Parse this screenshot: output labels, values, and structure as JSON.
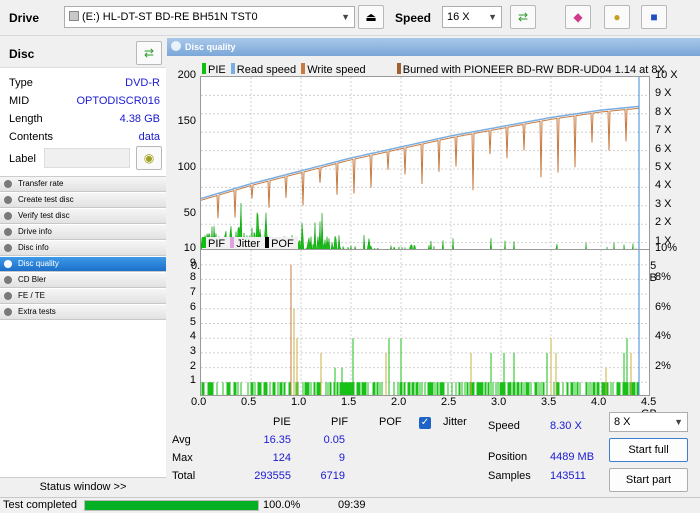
{
  "toolbar": {
    "drive_label": "Drive",
    "drive_value": "(E:)  HL-DT-ST BD-RE  BH51N TST0",
    "speed_label": "Speed",
    "speed_value": "16 X"
  },
  "disc": {
    "title": "Disc",
    "fields": [
      {
        "label": "Type",
        "value": "DVD-R"
      },
      {
        "label": "MID",
        "value": "OPTODISCR016"
      },
      {
        "label": "Length",
        "value": "4.38 GB"
      },
      {
        "label": "Contents",
        "value": "data"
      }
    ],
    "label_label": "Label",
    "label_value": ""
  },
  "nav": {
    "items": [
      {
        "label": "Transfer rate",
        "active": false
      },
      {
        "label": "Create test disc",
        "active": false
      },
      {
        "label": "Verify test disc",
        "active": false
      },
      {
        "label": "Drive info",
        "active": false
      },
      {
        "label": "Disc info",
        "active": false
      },
      {
        "label": "Disc quality",
        "active": true
      },
      {
        "label": "CD Bler",
        "active": false
      },
      {
        "label": "FE / TE",
        "active": false
      },
      {
        "label": "Extra tests",
        "active": false
      }
    ],
    "status_window": "Status window >>"
  },
  "panel": {
    "title": "Disc quality"
  },
  "chart_data": [
    {
      "type": "line",
      "legend": [
        "PIE",
        "Read speed",
        "Write speed",
        "Burned with PIONEER BD-RW   BDR-UD04 1.14 at 8X"
      ],
      "x_ticks": [
        "0.0",
        "0.5",
        "1.0",
        "1.5",
        "2.0",
        "2.5",
        "3.0",
        "3.5",
        "4.0",
        "4.5 GB"
      ],
      "y_left_ticks": [
        "200",
        "150",
        "100",
        "50"
      ],
      "y_right_ticks": [
        "10 X",
        "9 X",
        "8 X",
        "7 X",
        "6 X",
        "5 X",
        "4 X",
        "3 X",
        "2 X",
        "1 X"
      ],
      "xlim": [
        0,
        4.5
      ],
      "ylim_left": [
        0,
        200
      ],
      "ylim_right": [
        0,
        10
      ],
      "series": [
        {
          "name": "Read speed",
          "color": "#7aaee0",
          "x": [
            0.0,
            0.5,
            1.0,
            1.5,
            2.0,
            2.5,
            3.0,
            3.5,
            4.0,
            4.38
          ],
          "y": [
            3.4,
            4.2,
            4.9,
            5.6,
            6.2,
            6.8,
            7.3,
            7.8,
            8.2,
            8.4
          ]
        },
        {
          "name": "Write speed",
          "color": "#c87a40",
          "x": [
            0.0,
            0.5,
            1.0,
            1.5,
            2.0,
            2.5,
            3.0,
            3.5,
            4.0,
            4.38
          ],
          "y": [
            3.3,
            4.1,
            4.8,
            5.5,
            6.1,
            6.7,
            7.2,
            7.7,
            8.1,
            8.3
          ]
        }
      ],
      "pie_typical": 16.35,
      "pie_max": 124
    },
    {
      "type": "bar",
      "legend": [
        "PIF",
        "Jitter",
        "POF"
      ],
      "x_ticks": [
        "0.0",
        "0.5",
        "1.0",
        "1.5",
        "2.0",
        "2.5",
        "3.0",
        "3.5",
        "4.0",
        "4.5 GB"
      ],
      "y_left_ticks": [
        "10",
        "9",
        "8",
        "7",
        "6",
        "5",
        "4",
        "3",
        "2",
        "1"
      ],
      "y_right_ticks": [
        "10%",
        "8%",
        "6%",
        "4%",
        "2%"
      ],
      "xlim": [
        0,
        4.5
      ],
      "ylim_left": [
        0,
        10
      ],
      "ylim_right": [
        0,
        10
      ],
      "pif_typical": 0.05,
      "pif_max": 9
    }
  ],
  "stats": {
    "headers": [
      "PIE",
      "PIF",
      "POF"
    ],
    "jitter_label": "Jitter",
    "rows": [
      {
        "label": "Avg",
        "pie": "16.35",
        "pif": "0.05"
      },
      {
        "label": "Max",
        "pie": "124",
        "pif": "9"
      },
      {
        "label": "Total",
        "pie": "293555",
        "pif": "6719"
      }
    ],
    "speed_label": "Speed",
    "speed_value": "8.30 X",
    "position_label": "Position",
    "position_value": "4489 MB",
    "samples_label": "Samples",
    "samples_value": "143511",
    "speed_select": "8 X",
    "start_full": "Start full",
    "start_part": "Start part"
  },
  "status": {
    "text": "Test completed",
    "progress": 100.0,
    "percent_label": "100.0%",
    "time": "09:39"
  }
}
